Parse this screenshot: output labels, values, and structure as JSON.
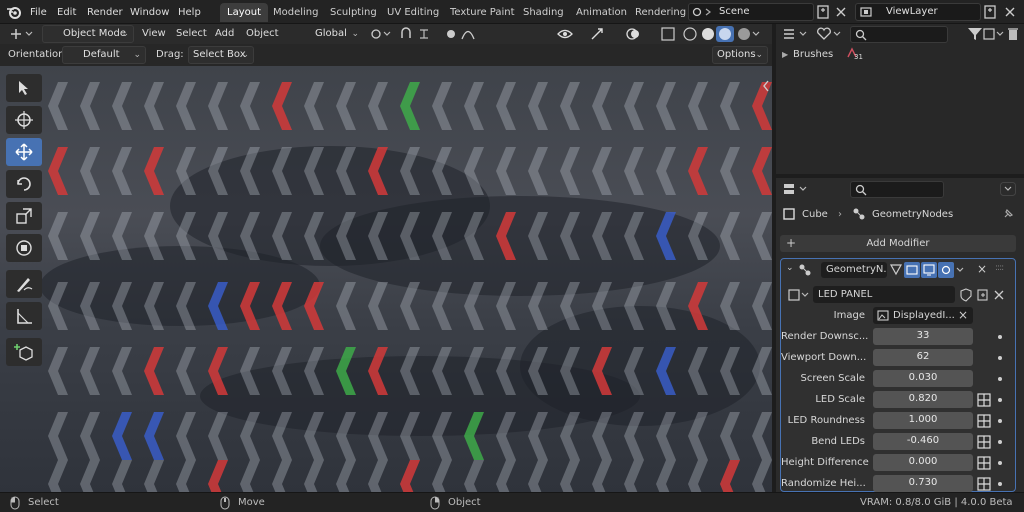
{
  "topbar": {
    "menus": [
      "File",
      "Edit",
      "Render",
      "Window",
      "Help"
    ],
    "workspaces": [
      "Layout",
      "Modeling",
      "Sculpting",
      "UV Editing",
      "Texture Paint",
      "Shading",
      "Animation",
      "Rendering"
    ],
    "active_workspace": "Layout",
    "scene": "Scene",
    "view_layer": "ViewLayer"
  },
  "viewport_header": {
    "mode": "Object Mode",
    "menus": [
      "View",
      "Select",
      "Add",
      "Object"
    ],
    "transform_orientation": "Global"
  },
  "viewport_subheader": {
    "orientation_label": "Orientation:",
    "orientation_value": "Default",
    "drag_label": "Drag:",
    "drag_value": "Select Box",
    "options_label": "Options"
  },
  "toolbar": {
    "tools": [
      "select-box",
      "cursor",
      "move",
      "rotate",
      "scale",
      "transform",
      "annotate",
      "measure",
      "add-cube"
    ],
    "active_tool": "move"
  },
  "outliner": {
    "row_label": "Brushes",
    "row_count": "31"
  },
  "properties": {
    "breadcrumb_object": "Cube",
    "breadcrumb_modifier": "GeometryNodes",
    "add_modifier_label": "Add Modifier",
    "modifier_name": "GeometryN...",
    "node_group": "LED PANEL",
    "image_label": "Image",
    "image_value": "DisplayedI...",
    "fields": [
      {
        "label": "Render Downsc...",
        "value": "33",
        "attr": false
      },
      {
        "label": "Viewport Down...",
        "value": "62",
        "attr": false
      },
      {
        "label": "Screen Scale",
        "value": "0.030",
        "attr": false
      },
      {
        "label": "LED Scale",
        "value": "0.820",
        "attr": true
      },
      {
        "label": "LED Roundness",
        "value": "1.000",
        "attr": true
      },
      {
        "label": "Bend LEDs",
        "value": "-0.460",
        "attr": true
      },
      {
        "label": "Height Difference",
        "value": "0.000",
        "attr": true
      },
      {
        "label": "Randomize Hei...",
        "value": "0.730",
        "attr": true
      }
    ]
  },
  "statusbar": {
    "select": "Select",
    "move": "Move",
    "object": "Object",
    "info": "VRAM: 0.8/8.0 GiB | 4.0.0 Beta"
  },
  "colors": {
    "accent": "#4772b3",
    "led_red": "#d23a3a",
    "led_green": "#3fb04a",
    "led_blue": "#3a5fd0"
  }
}
